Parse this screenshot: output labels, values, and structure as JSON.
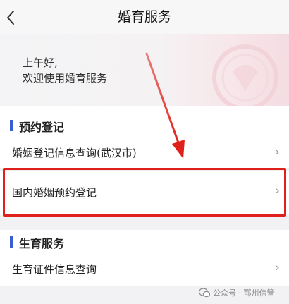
{
  "navbar": {
    "back_icon": "chevron-left-icon",
    "title": "婚育服务"
  },
  "banner": {
    "greeting_line1": "上午好,",
    "greeting_line2": "欢迎使用婚育服务"
  },
  "sections": [
    {
      "title": "预约登记",
      "items": [
        {
          "label": "婚姻登记信息查询(武汉市)",
          "icon": "chevron-right-icon"
        },
        {
          "label": "国内婚姻预约登记",
          "icon": "chevron-right-icon",
          "highlighted": true
        }
      ]
    },
    {
      "title": "生育服务",
      "items": [
        {
          "label": "生育证件信息查询",
          "icon": "chevron-right-icon"
        }
      ]
    }
  ],
  "annotation": {
    "arrow_color": "#e0201b",
    "box_color": "#e0201b"
  },
  "watermark": {
    "text": "公众号 · 鄂州信管"
  },
  "colors": {
    "accent_bar": "#3a5fd4",
    "background": "#f2f2f4"
  }
}
